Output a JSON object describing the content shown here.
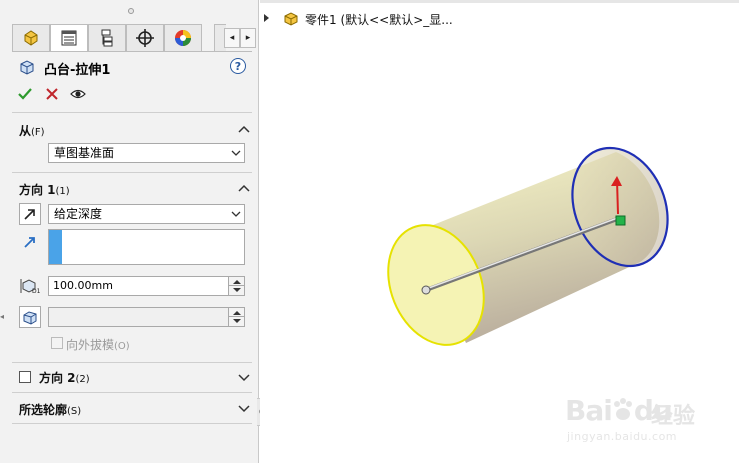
{
  "feature": {
    "title": "凸台-拉伸1"
  },
  "tabs": [
    {
      "name": "featuremanager"
    },
    {
      "name": "propertymanager"
    },
    {
      "name": "configurationmanager"
    },
    {
      "name": "dimxpert"
    },
    {
      "name": "appearance"
    }
  ],
  "tab_nav": {
    "prev": "◂",
    "next": "▸"
  },
  "help": "?",
  "sections": {
    "from": {
      "title": "从",
      "key": "(F)",
      "value": "草图基准面"
    },
    "direction1": {
      "title": "方向 1",
      "key": "(1)",
      "end_condition": "给定深度",
      "depth": "100.00mm",
      "draft_outward_label": "向外拔模",
      "draft_outward_key": "(O)"
    },
    "direction2": {
      "title": "方向 2",
      "key": "(2)"
    },
    "selected_contours": {
      "title": "所选轮廓",
      "key": "(S)"
    }
  },
  "tree": {
    "label": "零件1  (默认<<默认>_显..."
  },
  "watermark": {
    "brand": "Bai",
    "brand_tail": "du",
    "cn": "经验",
    "url": "jingyan.baidu.com"
  },
  "colors": {
    "accent_blue": "#4aa3e8",
    "ok_green": "#2e9a2e",
    "cancel_red": "#c0262c",
    "cylinder_yellow": "#f5f3b4",
    "edge_blue": "#1f2fb5",
    "edge_yellow": "#e6e200"
  }
}
